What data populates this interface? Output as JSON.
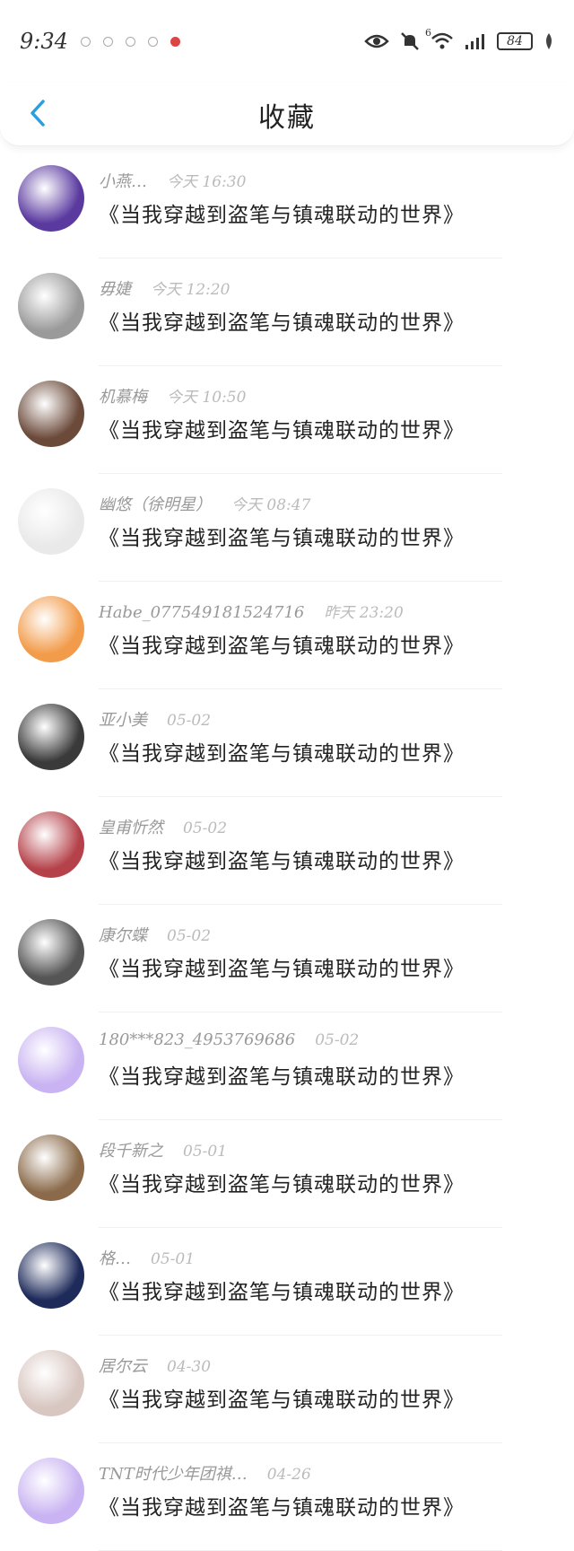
{
  "status_bar": {
    "time": "9:34",
    "signal_superscript": "6",
    "battery": "84"
  },
  "header": {
    "title": "收藏"
  },
  "items": [
    {
      "name": "小燕…",
      "time": "今天 16:30",
      "message": "《当我穿越到盗笔与镇魂联动的世界》",
      "avatar_color": "#5b3aa0"
    },
    {
      "name": "毋婕",
      "time": "今天 12:20",
      "message": "《当我穿越到盗笔与镇魂联动的世界》",
      "avatar_color": "#9a9a9a"
    },
    {
      "name": "机慕梅",
      "time": "今天 10:50",
      "message": "《当我穿越到盗笔与镇魂联动的世界》",
      "avatar_color": "#6b4a3a"
    },
    {
      "name": "幽悠（徐明星）",
      "time": "今天 08:47",
      "message": "《当我穿越到盗笔与镇魂联动的世界》",
      "avatar_color": "#e9e9e9"
    },
    {
      "name": "Habe_077549181524716",
      "time": "昨天 23:20",
      "message": "《当我穿越到盗笔与镇魂联动的世界》",
      "avatar_color": "#f29b4a"
    },
    {
      "name": "亚小美",
      "time": "05-02",
      "message": "《当我穿越到盗笔与镇魂联动的世界》",
      "avatar_color": "#3a3a3a"
    },
    {
      "name": "皇甫忻然",
      "time": "05-02",
      "message": "《当我穿越到盗笔与镇魂联动的世界》",
      "avatar_color": "#b5424a"
    },
    {
      "name": "康尔蝶",
      "time": "05-02",
      "message": "《当我穿越到盗笔与镇魂联动的世界》",
      "avatar_color": "#555555"
    },
    {
      "name": "180***823_4953769686",
      "time": "05-02",
      "message": "《当我穿越到盗笔与镇魂联动的世界》",
      "avatar_color": "#c9b3f2"
    },
    {
      "name": "段千新之",
      "time": "05-01",
      "message": "《当我穿越到盗笔与镇魂联动的世界》",
      "avatar_color": "#8a6a4a"
    },
    {
      "name": "格…",
      "time": "05-01",
      "message": "《当我穿越到盗笔与镇魂联动的世界》",
      "avatar_color": "#1d2a5a"
    },
    {
      "name": "居尔云",
      "time": "04-30",
      "message": "《当我穿越到盗笔与镇魂联动的世界》",
      "avatar_color": "#d8c6c0"
    },
    {
      "name": "TNT时代少年团祺…",
      "time": "04-26",
      "message": "《当我穿越到盗笔与镇魂联动的世界》",
      "avatar_color": "#c9b3f2"
    }
  ]
}
